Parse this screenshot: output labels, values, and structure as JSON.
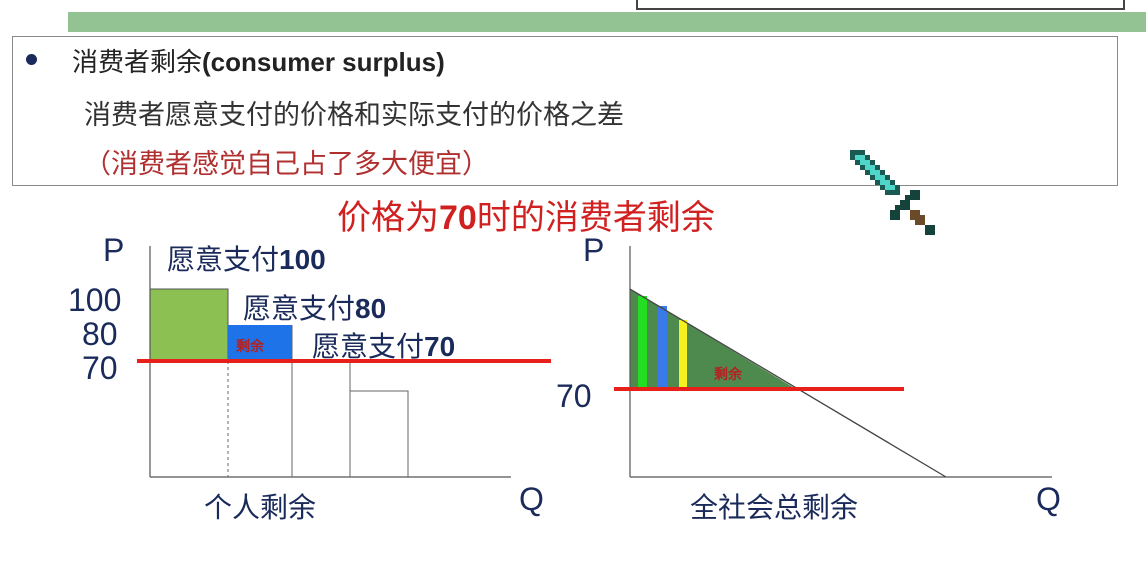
{
  "header": {
    "term": "消费者剩余",
    "term_en": "(consumer surplus)",
    "definition": "消费者愿意支付的价格和实际支付的价格之差",
    "note": "（消费者感觉自己占了多大便宜）"
  },
  "title": {
    "pre": "价格为",
    "price": "70",
    "post": "时的消费者剩余"
  },
  "left_chart": {
    "p_axis": "P",
    "q_axis": "Q",
    "caption": "个人剩余",
    "ticks": [
      "100",
      "80",
      "70"
    ],
    "wtp_prefix": "愿意支付",
    "wtp_values": [
      "100",
      "80",
      "70"
    ],
    "surplus_label": "剩余"
  },
  "right_chart": {
    "p_axis": "P",
    "q_axis": "Q",
    "caption": "全社会总剩余",
    "tick": "70",
    "surplus_label": "剩余"
  },
  "colors": {
    "green_block": "#8cc052",
    "blue_block": "#1e73e8",
    "price_line": "#e8201a",
    "surplus_triangle": "#4e8a4e",
    "text_navy": "#1a2a5a",
    "red_text": "#b22222",
    "stripes": [
      "#22dd22",
      "#3a7ae8",
      "#f5f020"
    ]
  },
  "icons": {
    "decor": "sword-icon"
  }
}
